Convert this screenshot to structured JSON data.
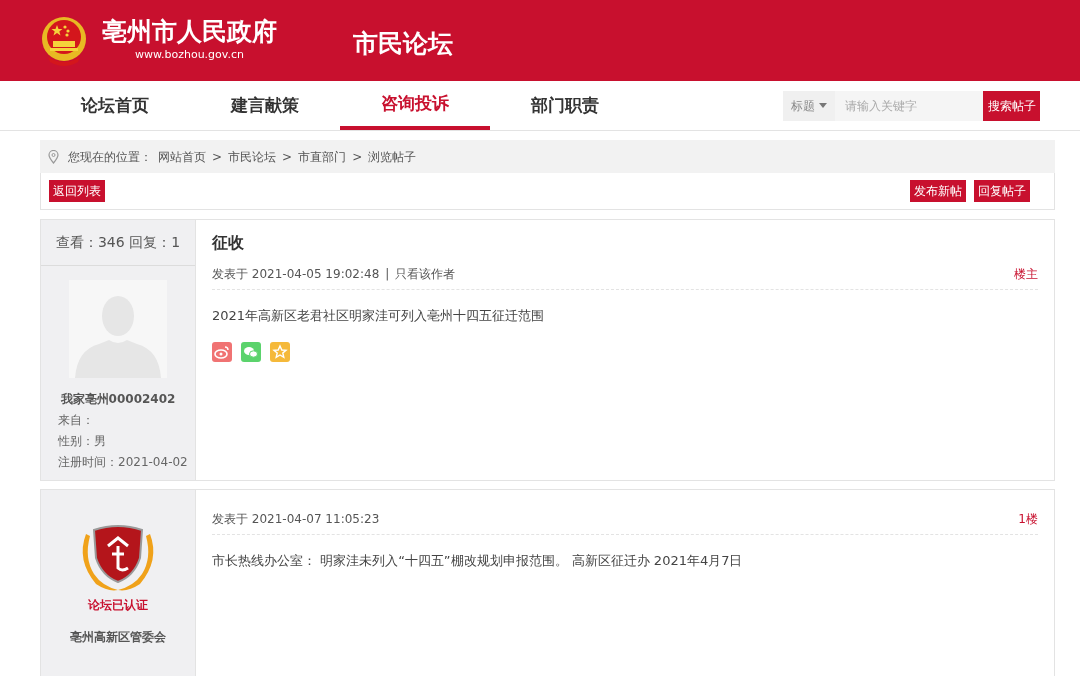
{
  "header": {
    "site_title": "亳州市人民政府",
    "site_url": "www.bozhou.gov.cn",
    "forum_title": "市民论坛"
  },
  "nav": {
    "items": [
      {
        "label": "论坛首页",
        "selected": false
      },
      {
        "label": "建言献策",
        "selected": false
      },
      {
        "label": "咨询投诉",
        "selected": true
      },
      {
        "label": "部门职责",
        "selected": false
      }
    ]
  },
  "search": {
    "scope": "标题",
    "placeholder": "请输入关键字",
    "button": "搜索帖子"
  },
  "breadcrumb": {
    "prefix": "您现在的位置：",
    "separator": ">",
    "items": [
      "网站首页",
      "市民论坛",
      "市直部门",
      "浏览帖子"
    ]
  },
  "toolbar": {
    "back_button": "返回列表",
    "actions": [
      "发布新帖",
      "回复帖子"
    ]
  },
  "posts": [
    {
      "author": {
        "kind": "user",
        "stats": "查看：346 回复：1",
        "name": "我家亳州00002402",
        "fields": [
          "来自：",
          "性别：男",
          "注册时间：2021-04-02"
        ]
      },
      "title": "征收",
      "meta": "发表于 2021-04-05 19:02:48",
      "meta_separator": "|",
      "author_filter": "只看该作者",
      "floor": "楼主",
      "body": "2021年高新区老君社区明家洼可列入亳州十四五征迁范围",
      "share": true
    },
    {
      "author": {
        "kind": "verified",
        "badge": "论坛已认证",
        "name": "亳州高新区管委会"
      },
      "meta": "发表于 2021-04-07 11:05:23",
      "floor": "1楼",
      "body": "市长热线办公室： 明家洼未列入“十四五”棚改规划申报范围。 高新区征迁办 2021年4月7日",
      "share": false
    }
  ]
}
